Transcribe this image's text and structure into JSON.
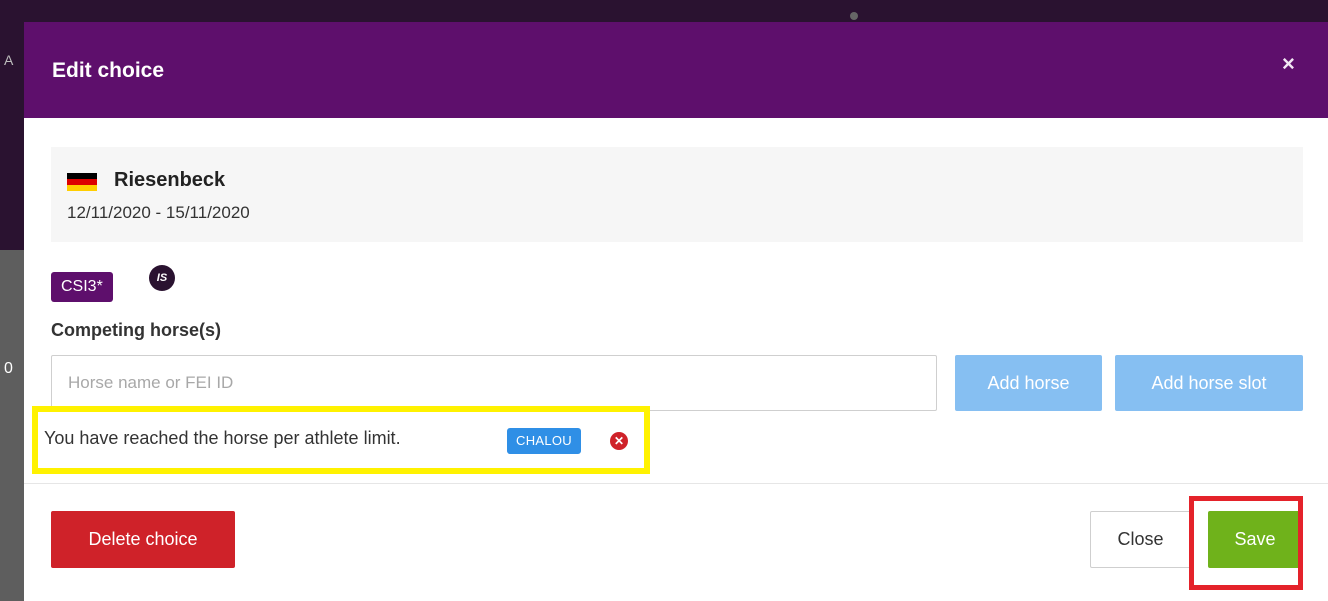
{
  "modal": {
    "title": "Edit choice",
    "close_icon": "×"
  },
  "event": {
    "flag": "germany-flag",
    "flag_colors": [
      "#000000",
      "#dd0000",
      "#ffce00"
    ],
    "name": "Riesenbeck",
    "dates": "12/11/2020 - 15/11/2020"
  },
  "competition": {
    "badge": "CSI3*",
    "is_icon_label": "IS"
  },
  "horses": {
    "label": "Competing horse(s)",
    "input_placeholder": "Horse name or FEI ID",
    "input_value": "",
    "add_horse_label": "Add horse",
    "add_slot_label": "Add horse slot",
    "limit_message": "You have reached the horse per athlete limit.",
    "selected_tags": [
      "CHALOU"
    ],
    "remove_icon": "✕"
  },
  "footer": {
    "delete_label": "Delete choice",
    "close_label": "Close",
    "save_label": "Save"
  },
  "annotations": {
    "highlight_limit_color": "#fff200",
    "highlight_save_color": "#e4222a"
  },
  "colors": {
    "header": "#5e0f6c",
    "primary_light": "#86bff2",
    "danger": "#cf2229",
    "success": "#6fb21b",
    "tag": "#2f8fe6"
  }
}
